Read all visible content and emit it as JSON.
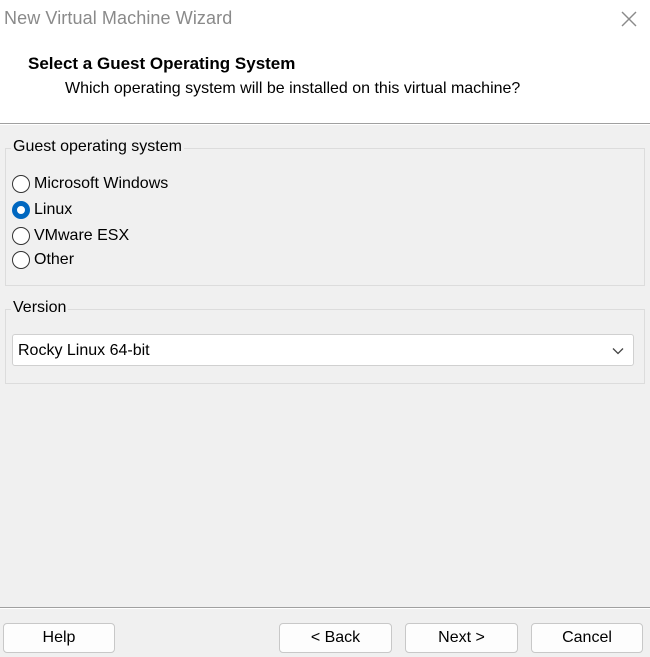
{
  "window": {
    "title": "New Virtual Machine Wizard",
    "close_icon": "close-icon"
  },
  "header": {
    "title": "Select a Guest Operating System",
    "subtitle": "Which operating system will be installed on this virtual machine?"
  },
  "guest_os": {
    "label": "Guest operating system",
    "options": [
      {
        "label": "Microsoft Windows",
        "selected": false
      },
      {
        "label": "Linux",
        "selected": true
      },
      {
        "label": "VMware ESX",
        "selected": false
      },
      {
        "label": "Other",
        "selected": false
      }
    ]
  },
  "version": {
    "label": "Version",
    "selected_value": "Rocky Linux 64-bit",
    "arrow_icon": "chevron-down-icon"
  },
  "buttons": {
    "help": "Help",
    "back": "< Back",
    "next": "Next >",
    "cancel": "Cancel"
  },
  "colors": {
    "accent": "#0067c0",
    "title_text": "#8a8a8a",
    "background": "#f0f0f0"
  }
}
